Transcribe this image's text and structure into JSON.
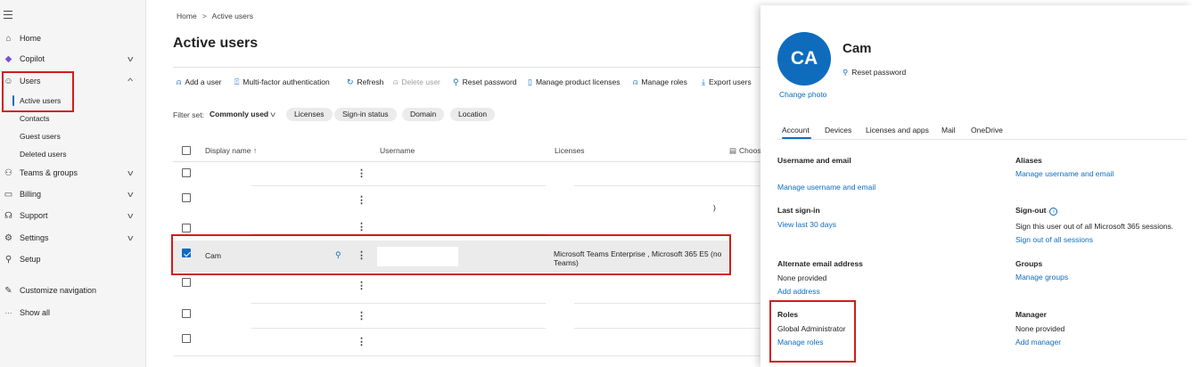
{
  "sidebar": {
    "items": [
      {
        "label": "Home",
        "icon": "home-icon",
        "glyph": "⌂"
      },
      {
        "label": "Copilot",
        "icon": "copilot-icon",
        "glyph": "◆"
      },
      {
        "label": "Users",
        "icon": "user-icon",
        "glyph": "⍝"
      },
      {
        "label": "Teams & groups",
        "icon": "teams-icon",
        "glyph": "⚇"
      },
      {
        "label": "Billing",
        "icon": "billing-icon",
        "glyph": "▭"
      },
      {
        "label": "Support",
        "icon": "support-icon",
        "glyph": "☊"
      },
      {
        "label": "Settings",
        "icon": "gear-icon",
        "glyph": "⚙"
      },
      {
        "label": "Setup",
        "icon": "setup-icon",
        "glyph": "⚲"
      },
      {
        "label": "Customize navigation",
        "icon": "pencil-icon",
        "glyph": "✎"
      },
      {
        "label": "Show all",
        "icon": "ellipsis-icon",
        "glyph": "···"
      }
    ],
    "users_sub": [
      "Active users",
      "Contacts",
      "Guest users",
      "Deleted users"
    ]
  },
  "breadcrumb": {
    "home": "Home",
    "sep": ">",
    "current": "Active users"
  },
  "page_title": "Active users",
  "toolbar": {
    "add_user": "Add a user",
    "mfa": "Multi-factor authentication",
    "refresh": "Refresh",
    "delete_user": "Delete user",
    "reset_password": "Reset password",
    "manage_licenses": "Manage product licenses",
    "manage_roles": "Manage roles",
    "export_users": "Export users"
  },
  "filters": {
    "label": "Filter set:",
    "selected": "Commonly used",
    "pills": [
      "Licenses",
      "Sign-in status",
      "Domain",
      "Location"
    ]
  },
  "table": {
    "columns": [
      "Display name ↑",
      "Username",
      "Licenses",
      "Choos"
    ],
    "selected_row": {
      "display_name": "Cam",
      "licenses": "Microsoft Teams Enterprise , Microsoft 365 E5 (no Teams)"
    },
    "stray_char": ")"
  },
  "panel": {
    "initials": "CA",
    "change_photo": "Change photo",
    "name": "Cam",
    "reset_password": "Reset password",
    "tabs": [
      "Account",
      "Devices",
      "Licenses and apps",
      "Mail",
      "OneDrive"
    ],
    "username_email": {
      "title": "Username and email",
      "link": "Manage username and email"
    },
    "aliases": {
      "title": "Aliases",
      "link": "Manage username and email"
    },
    "last_signin": {
      "title": "Last sign-in",
      "link": "View last 30 days"
    },
    "signout": {
      "title": "Sign-out",
      "text": "Sign this user out of all Microsoft 365 sessions.",
      "link": "Sign out of all sessions"
    },
    "alt_email": {
      "title": "Alternate email address",
      "text": "None provided",
      "link": "Add address"
    },
    "groups": {
      "title": "Groups",
      "link": "Manage groups"
    },
    "roles": {
      "title": "Roles",
      "text": "Global Administrator",
      "link": "Manage roles"
    },
    "manager": {
      "title": "Manager",
      "text": "None provided",
      "link": "Add manager"
    }
  },
  "colors": {
    "accent": "#0f6cbd",
    "highlight": "#d21c1c"
  }
}
